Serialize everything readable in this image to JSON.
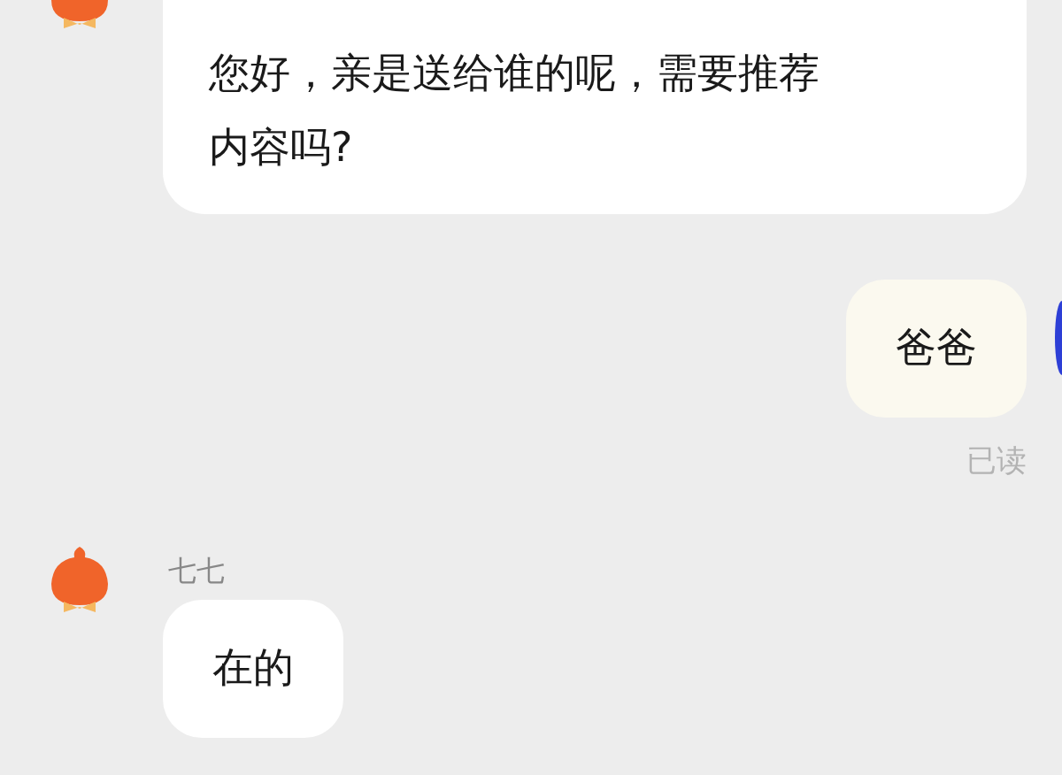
{
  "messages": [
    {
      "kind": "received",
      "text": "您好，亲是送给谁的呢，需要推荐内容吗?"
    },
    {
      "kind": "sent",
      "text": "爸爸",
      "receipt": "已读"
    },
    {
      "kind": "received",
      "sender": "七七",
      "text": "在的"
    }
  ]
}
